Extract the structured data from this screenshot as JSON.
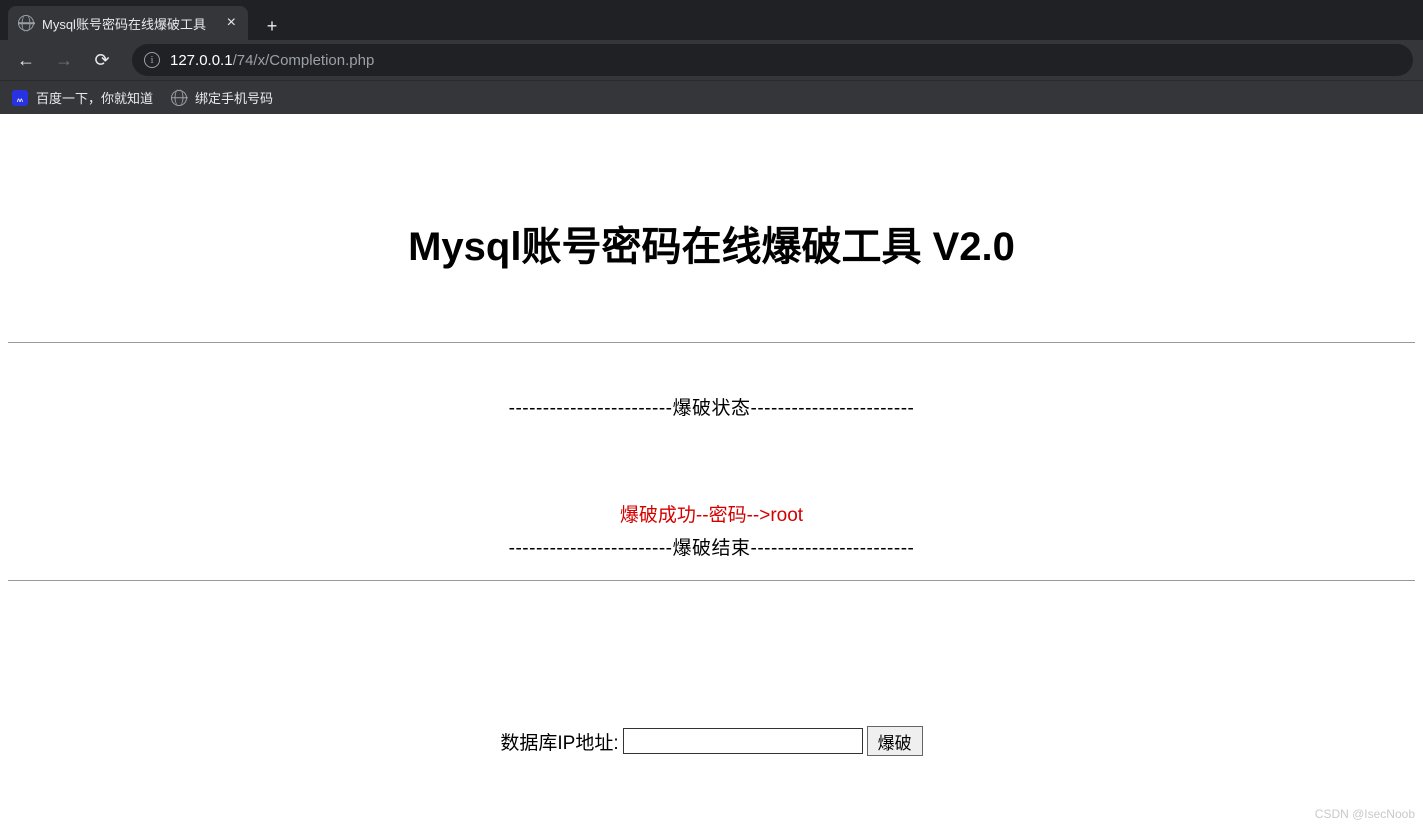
{
  "browser": {
    "tab_title": "Mysql账号密码在线爆破工具",
    "url_host": "127.0.0.1",
    "url_path": "/74/x/Completion.php",
    "bookmarks": [
      {
        "label": "百度一下，你就知道"
      },
      {
        "label": "绑定手机号码"
      }
    ]
  },
  "page": {
    "title": "Mysql账号密码在线爆破工具 V2.0",
    "status_section": "------------------------爆破状态------------------------",
    "result_text": "爆破成功--密码-->root",
    "end_section": "------------------------爆破结束------------------------",
    "form_label": "数据库IP地址:",
    "submit_label": "爆破",
    "ip_value": ""
  },
  "watermark": "CSDN @IsecNoob"
}
